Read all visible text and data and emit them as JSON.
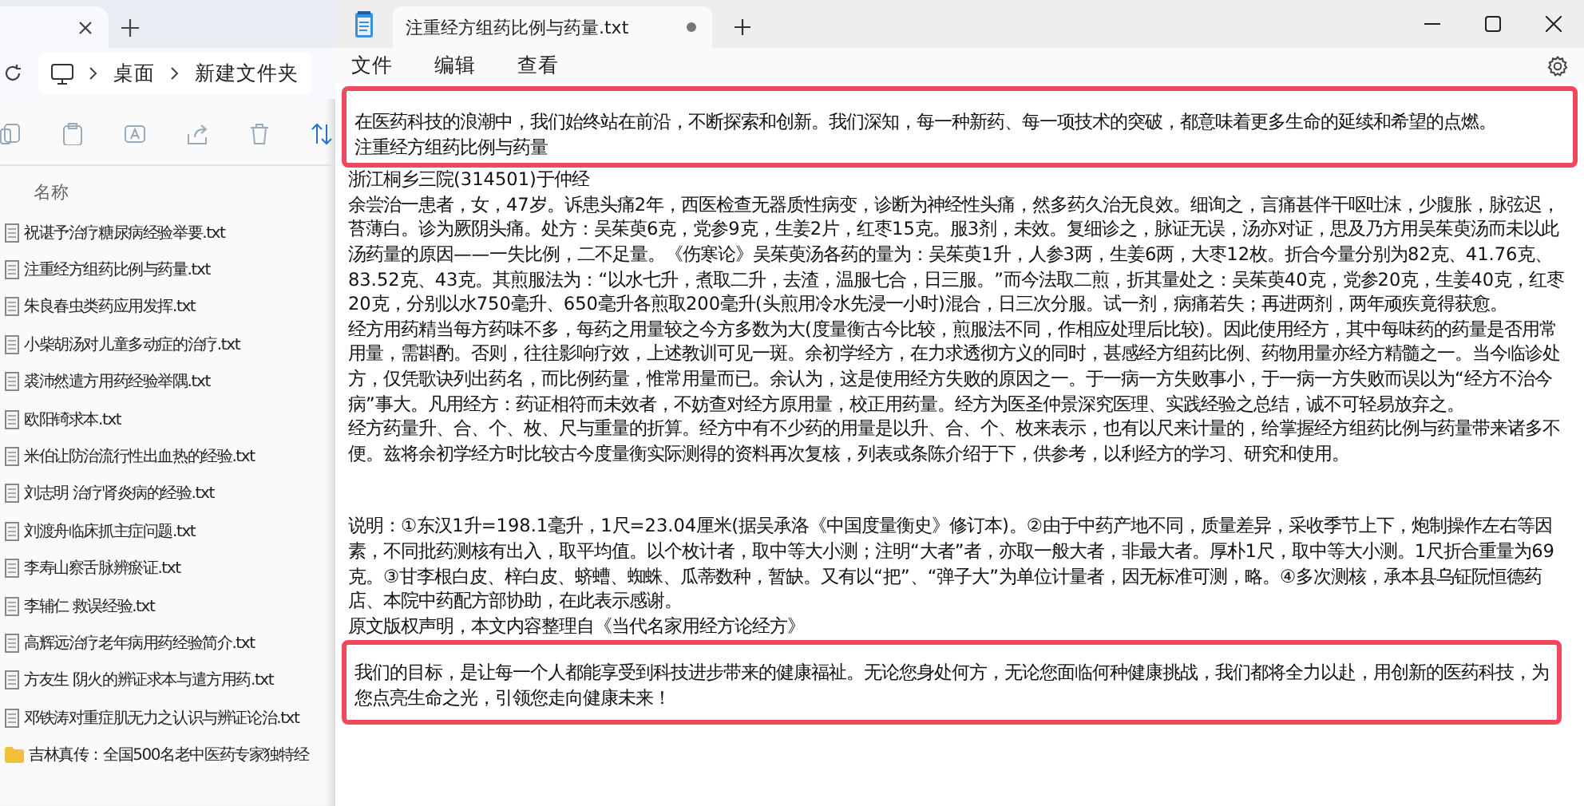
{
  "explorer": {
    "breadcrumb": [
      "桌面",
      "新建文件夹"
    ],
    "column_header": "名称",
    "items": [
      {
        "name": "祝谌予治疗糖尿病经验举要.txt",
        "kind": "file"
      },
      {
        "name": "注重经方组药比例与药量.txt",
        "kind": "file"
      },
      {
        "name": "朱良春虫类药应用发挥.txt",
        "kind": "file"
      },
      {
        "name": "小柴胡汤对儿童多动症的治疗.txt",
        "kind": "file"
      },
      {
        "name": "裘沛然遣方用药经验举隅.txt",
        "kind": "file"
      },
      {
        "name": "欧阳锜求本.txt",
        "kind": "file"
      },
      {
        "name": "米伯让防治流行性出血热的经验.txt",
        "kind": "file"
      },
      {
        "name": "刘志明   治疗肾炎病的经验.txt",
        "kind": "file"
      },
      {
        "name": "刘渡舟临床抓主症问题.txt",
        "kind": "file"
      },
      {
        "name": "李寿山察舌脉辨瘀证.txt",
        "kind": "file"
      },
      {
        "name": "李辅仁     救误经验.txt",
        "kind": "file"
      },
      {
        "name": "高辉远治疗老年病用药经验简介.txt",
        "kind": "file"
      },
      {
        "name": "方友生   阴火的辨证求本与遣方用药.txt",
        "kind": "file"
      },
      {
        "name": "邓铁涛对重症肌无力之认识与辨证论治.txt",
        "kind": "file"
      },
      {
        "name": "吉林真传：全国500名老中医药专家独特经",
        "kind": "folder"
      }
    ]
  },
  "notepad": {
    "tab_title": "注重经方组药比例与药量.txt",
    "unsaved": true,
    "menu": [
      "文件",
      "编辑",
      "查看"
    ],
    "blocks": [
      {
        "kind": "highlight",
        "lines": [
          "在医药科技的浪潮中，我们始终站在前沿，不断探索和创新。我们深知，每一种新药、每一项技术的突破，都意味着更多生命的延续和希望的点燃。",
          "注重经方组药比例与药量"
        ]
      },
      {
        "kind": "text",
        "text": "浙江桐乡三院(314501)于仲经"
      },
      {
        "kind": "text",
        "text": "余尝治一患者，女，47岁。诉患头痛2年，西医检查无器质性病变，诊断为神经性头痛，然多药久治无良效。细询之，言痛甚伴干呕吐沫，少腹胀，脉弦迟，苔薄白。诊为厥阴头痛。处方：吴茱萸6克，党参9克，生姜2片，红枣15克。服3剂，未效。复细诊之，脉证无误，汤亦对证，思及乃方用吴茱萸汤而未以此汤药量的原因——一失比例，二不足量。《伤寒论》吴茱萸汤各药的量为：吴茱萸1升，人参3两，生姜6两，大枣12枚。折合今量分别为82克、41.76克、83.52克、43克。其煎服法为：“以水七升，煮取二升，去渣，温服七合，日三服。”而今法取二煎，折其量处之：吴茱萸40克，党参20克，生姜40克，红枣20克，分别以水750毫升、650毫升各煎取200毫升(头煎用冷水先浸一小时)混合，日三次分服。试一剂，病痛若失；再进两剂，两年顽疾竟得获愈。"
      },
      {
        "kind": "text",
        "text": "经方用药精当每方药味不多，每药之用量较之今方多数为大(度量衡古今比较，煎服法不同，作相应处理后比较)。因此使用经方，其中每味药的药量是否用常用量，需斟酌。否则，往往影响疗效，上述教训可见一斑。余初学经方，在力求透彻方义的同时，甚感经方组药比例、药物用量亦经方精髓之一。当今临诊处方，仅凭歌诀列出药名，而比例药量，惟常用量而已。余认为，这是使用经方失败的原因之一。于一病一方失败事小，于一病一方失败而误以为“经方不治今病”事大。凡用经方：药证相符而未效者，不妨查对经方原用量，校正用药量。经方为医圣仲景深究医理、实践经验之总结，诚不可轻易放弃之。"
      },
      {
        "kind": "text",
        "text": "经方药量升、合、个、枚、尺与重量的折算。经方中有不少药的用量是以升、合、个、枚来表示，也有以尺来计量的，给掌握经方组药比例与药量带来诸多不便。兹将余初学经方时比较古今度量衡实际测得的资料再次复核，列表或条陈介绍于下，供参考，以利经方的学习、研究和使用。"
      },
      {
        "kind": "spacer"
      },
      {
        "kind": "text",
        "text": "说明：①东汉1升=198.1毫升，1尺=23.04厘米(据吴承洛《中国度量衡史》修订本)。②由于中药产地不同，质量差异，采收季节上下，炮制操作左右等因素，不同批药测核有出入，取平均值。以个枚计者，取中等大小测；注明“大者”者，亦取一般大者，非最大者。厚朴1尺，取中等大小测。1尺折合重量为69克。③甘李根白皮、梓白皮、蛴螬、蜘蛛、瓜蒂数种，暂缺。又有以“把”、“弹子大”为单位计量者，因无标准可测，略。④多次测核，承本县乌钲阮恒德药店、本院中药配方部协助，在此表示感谢。"
      },
      {
        "kind": "text",
        "text": "原文版权声明，本文内容整理自《当代名家用经方论经方》"
      },
      {
        "kind": "highlight",
        "lines": [
          "我们的目标，是让每一个人都能享受到科技进步带来的健康福祉。无论您身处何方，无论您面临何种健康挑战，我们都将全力以赴，用创新的医药科技，为您点亮生命之光，引领您走向健康未来！"
        ]
      }
    ]
  }
}
